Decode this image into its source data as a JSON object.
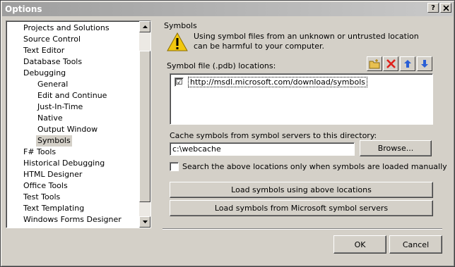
{
  "window": {
    "title": "Options",
    "help_label": "?",
    "close_label": "X"
  },
  "tree": {
    "items": [
      {
        "label": "Projects and Solutions",
        "indent": 0
      },
      {
        "label": "Source Control",
        "indent": 0
      },
      {
        "label": "Text Editor",
        "indent": 0
      },
      {
        "label": "Database Tools",
        "indent": 0
      },
      {
        "label": "Debugging",
        "indent": 0
      },
      {
        "label": "General",
        "indent": 1
      },
      {
        "label": "Edit and Continue",
        "indent": 1
      },
      {
        "label": "Just-In-Time",
        "indent": 1
      },
      {
        "label": "Native",
        "indent": 1
      },
      {
        "label": "Output Window",
        "indent": 1
      },
      {
        "label": "Symbols",
        "indent": 1,
        "selected": true
      },
      {
        "label": "F# Tools",
        "indent": 0
      },
      {
        "label": "Historical Debugging",
        "indent": 0
      },
      {
        "label": "HTML Designer",
        "indent": 0
      },
      {
        "label": "Office Tools",
        "indent": 0
      },
      {
        "label": "Test Tools",
        "indent": 0
      },
      {
        "label": "Text Templating",
        "indent": 0
      },
      {
        "label": "Windows Forms Designer",
        "indent": 0
      }
    ]
  },
  "symbols": {
    "section_title": "Symbols",
    "warning_text": "Using symbol files from an unknown or untrusted location can be harmful to your computer.",
    "locations_label": "Symbol file (.pdb) locations:",
    "locations": [
      {
        "url": "http://msdl.microsoft.com/download/symbols",
        "checked": true
      }
    ],
    "checked_mark": "☑",
    "cache_label": "Cache symbols from symbol servers to this directory:",
    "cache_value": "c:\\webcache",
    "browse_label": "Browse...",
    "manual_label": "Search the above locations only when symbols are loaded manually",
    "manual_checked": false,
    "load_above_label": "Load symbols using above locations",
    "load_ms_label": "Load symbols from Microsoft symbol servers"
  },
  "footer": {
    "ok_label": "OK",
    "cancel_label": "Cancel"
  },
  "colors": {
    "warning": "#f2c80f",
    "delete": "#e0201a",
    "arrows": "#2a5fd6",
    "folder": "#e8c050"
  }
}
